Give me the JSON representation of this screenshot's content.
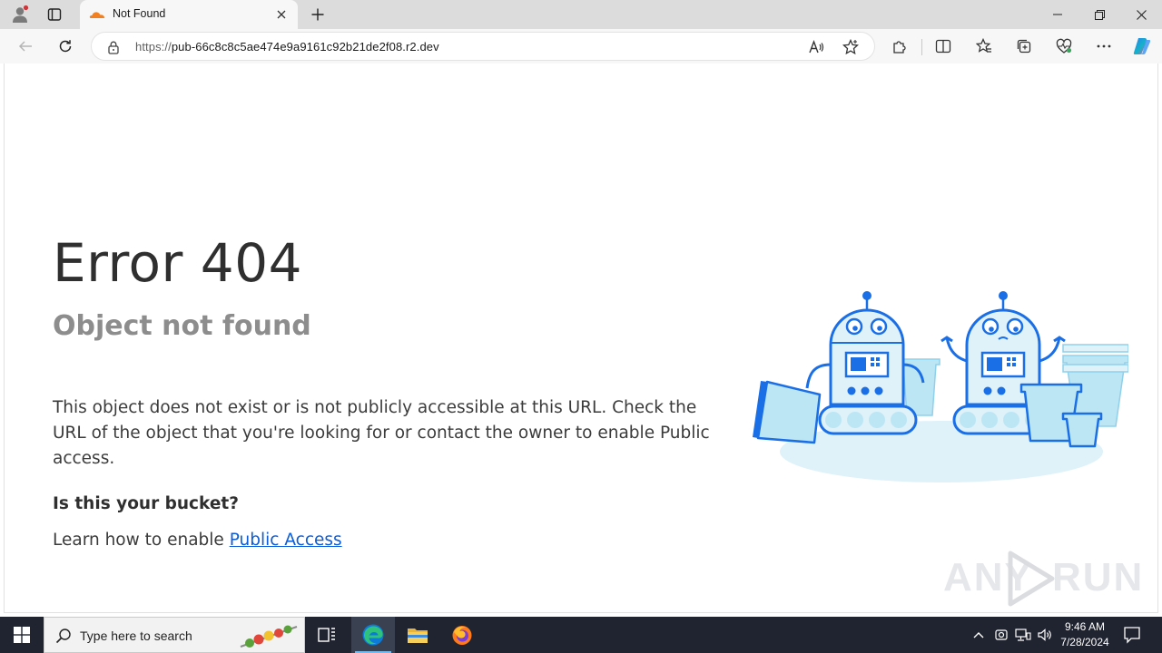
{
  "browser": {
    "tab": {
      "title": "Not Found"
    },
    "address": {
      "scheme": "https://",
      "host": "pub-66c8c8c5ae474e9a9161c92b21de2f08.r2.dev"
    }
  },
  "page": {
    "error_title": "Error 404",
    "error_subtitle": "Object not found",
    "description": "This object does not exist or is not publicly accessible at this URL. Check the URL of the object that you're looking for or contact the owner to enable Public access.",
    "bucket_question": "Is this your bucket?",
    "learn_prefix": "Learn how to enable ",
    "learn_link": "Public Access"
  },
  "watermark": {
    "left": "ANY",
    "right": "RUN"
  },
  "taskbar": {
    "search_placeholder": "Type here to search",
    "clock_time": "9:46 AM",
    "clock_date": "7/28/2024"
  },
  "colors": {
    "tab_bar": "#dcdcdc",
    "toolbar": "#f7f7f7",
    "link": "#0b5cd8",
    "taskbar": "#1f2430",
    "robot_blue": "#1a6ee6",
    "robot_light": "#bde6f5"
  }
}
